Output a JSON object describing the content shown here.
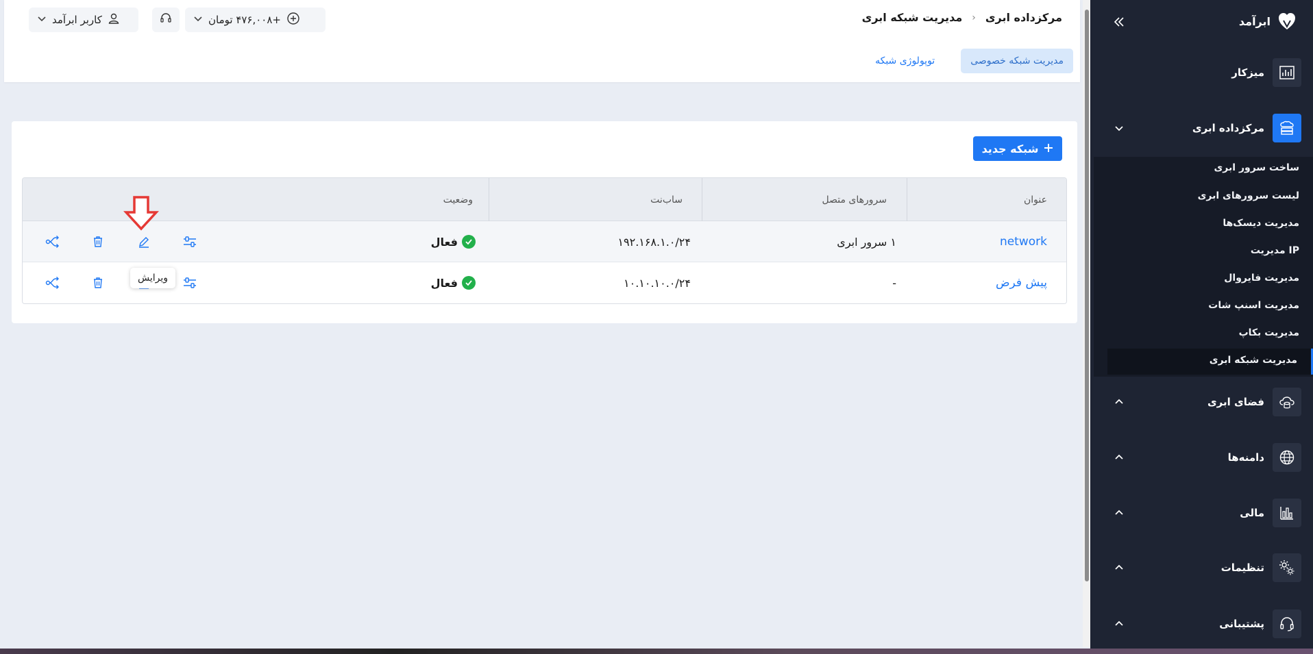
{
  "sidebar": {
    "logo": "ابرآمد",
    "main_items": [
      {
        "label": "میزکار",
        "icon": "dashboard-chart-icon"
      },
      {
        "label": "مرکزداده ابری",
        "icon": "datacenter-icon"
      },
      {
        "label": "فضای ابری",
        "icon": "cloud-storage-icon"
      },
      {
        "label": "دامنه‌ها",
        "icon": "globe-icon"
      },
      {
        "label": "مالی",
        "icon": "finance-chart-icon"
      },
      {
        "label": "تنظیمات",
        "icon": "gears-icon"
      },
      {
        "label": "پشتیبانی",
        "icon": "headset-icon"
      }
    ],
    "submenu": [
      "ساخت سرور ابری",
      "لیست سرورهای ابری",
      "مدیریت دیسک‌ها",
      "مدیریت IP",
      "مدیریت فایروال",
      "مدیریت اسنپ شات",
      "مدیریت بکاپ",
      "مدیریت شبکه ابری"
    ],
    "active_submenu": "مدیریت شبکه ابری"
  },
  "header": {
    "breadcrumb": [
      "مرکزداده ابری",
      "مدیریت شبکه ابری"
    ],
    "user_label": "کاربر ابرآمد",
    "balance_label": "+۴۷۶,۰۰۸ تومان",
    "tabs": [
      "مدیریت شبکه خصوصی",
      "توپولوژی شبکه"
    ],
    "active_tab": "مدیریت شبکه خصوصی"
  },
  "main": {
    "new_button": "شبکه جدید",
    "columns": [
      "عنوان",
      "سرورهای متصل",
      "ساب‌نت",
      "وضعیت"
    ],
    "rows": [
      {
        "title": "network",
        "servers": "۱ سرور ابری",
        "subnet": "۱۹۲.۱۶۸.۱.۰/۲۴",
        "status": "فعال"
      },
      {
        "title": "پیش فرض",
        "servers": "-",
        "subnet": "۱۰.۱۰.۱۰.۰/۲۴",
        "status": "فعال"
      }
    ],
    "tooltip": "ویرایش"
  },
  "colors": {
    "primary": "#1f78f4",
    "sidebar_bg": "#1e2433",
    "status_ok": "#22b04b",
    "annotation_arrow": "#e53935"
  }
}
